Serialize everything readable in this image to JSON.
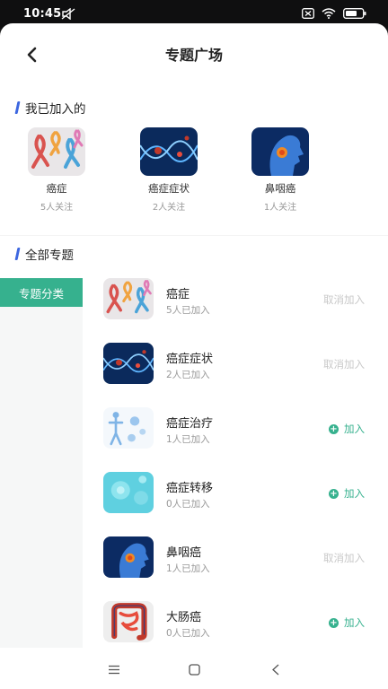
{
  "status": {
    "time": "10:45"
  },
  "header": {
    "title": "专题广场"
  },
  "joined_section": {
    "title": "我已加入的",
    "items": [
      {
        "name": "癌症",
        "count": "5人关注",
        "icon": "ribbons-image"
      },
      {
        "name": "癌症症状",
        "count": "2人关注",
        "icon": "dna-cells-image"
      },
      {
        "name": "鼻咽癌",
        "count": "1人关注",
        "icon": "nasopharynx-image"
      }
    ]
  },
  "all_section": {
    "title": "全部专题",
    "category_tab": "专题分类",
    "items": [
      {
        "name": "癌症",
        "count": "5人已加入",
        "action": "取消加入",
        "joined": true,
        "icon": "ribbons-image"
      },
      {
        "name": "癌症症状",
        "count": "2人已加入",
        "action": "取消加入",
        "joined": true,
        "icon": "dna-cells-image"
      },
      {
        "name": "癌症治疗",
        "count": "1人已加入",
        "action": "加入",
        "joined": false,
        "icon": "body-cells-image"
      },
      {
        "name": "癌症转移",
        "count": "0人已加入",
        "action": "加入",
        "joined": false,
        "icon": "cyan-cells-image"
      },
      {
        "name": "鼻咽癌",
        "count": "1人已加入",
        "action": "取消加入",
        "joined": true,
        "icon": "nasopharynx-image"
      },
      {
        "name": "大肠癌",
        "count": "0人已加入",
        "action": "加入",
        "joined": false,
        "icon": "intestine-image"
      }
    ]
  },
  "colors": {
    "accent": "#36b18e",
    "section_bar": "#3d67e0",
    "muted": "#c8c8c8"
  }
}
